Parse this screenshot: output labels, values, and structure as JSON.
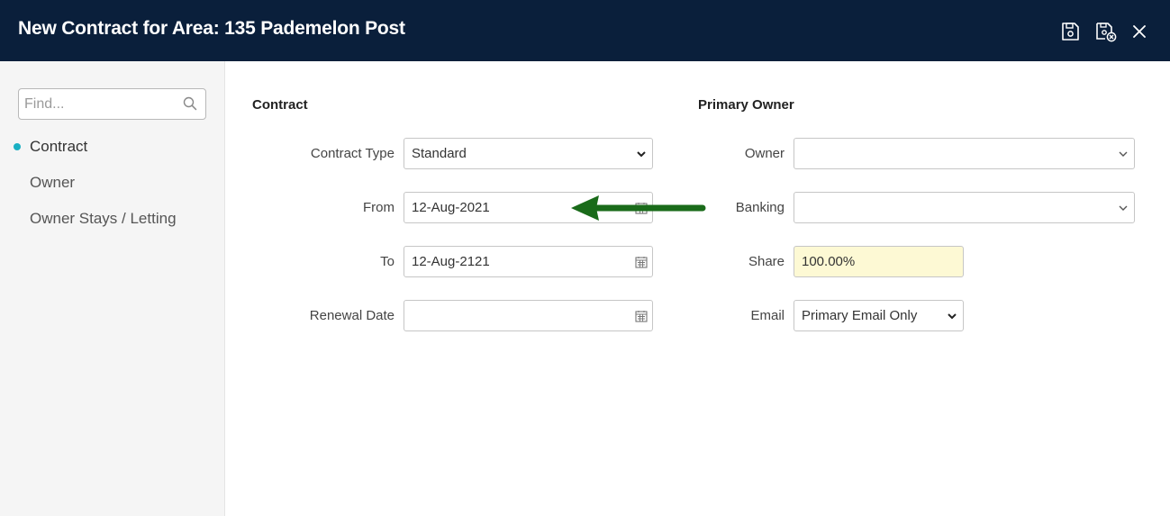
{
  "header": {
    "title": "New Contract for Area: 135 Pademelon Post",
    "icons": [
      "save-icon",
      "save-close-icon",
      "close-icon"
    ]
  },
  "sidebar": {
    "search_placeholder": "Find...",
    "items": [
      {
        "label": "Contract",
        "active": true
      },
      {
        "label": "Owner",
        "active": false
      },
      {
        "label": "Owner Stays / Letting",
        "active": false
      }
    ]
  },
  "contract": {
    "section_title": "Contract",
    "contract_type_label": "Contract Type",
    "contract_type_value": "Standard",
    "from_label": "From",
    "from_value": "12-Aug-2021",
    "to_label": "To",
    "to_value": "12-Aug-2121",
    "renewal_label": "Renewal Date",
    "renewal_value": ""
  },
  "primary_owner": {
    "section_title": "Primary Owner",
    "owner_label": "Owner",
    "owner_value": "",
    "banking_label": "Banking",
    "banking_value": "",
    "share_label": "Share",
    "share_value": "100.00%",
    "email_label": "Email",
    "email_value": "Primary Email Only"
  },
  "colors": {
    "header_bg": "#0a1f3b",
    "accent_dot": "#1ab0c3",
    "share_bg": "#fdf9d4",
    "annotation_arrow": "#1a6b1a"
  }
}
